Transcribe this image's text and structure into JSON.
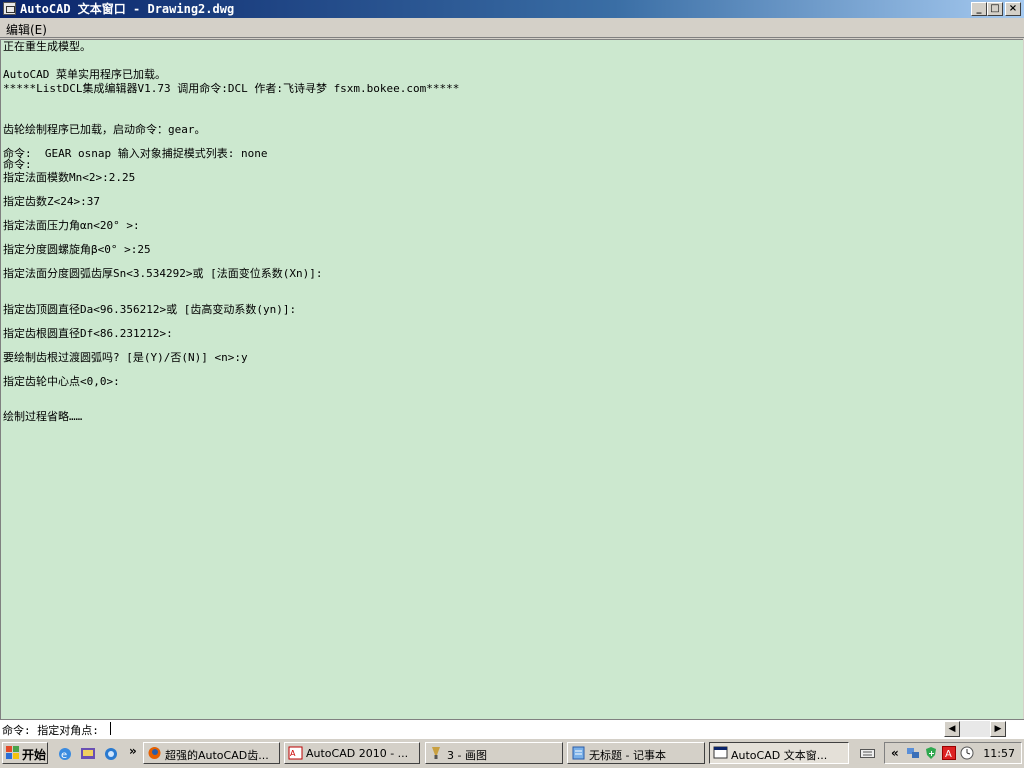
{
  "window": {
    "title": "AutoCAD 文本窗口 - Drawing2.dwg",
    "minimize_glyph": "_",
    "maximize_glyph": "□",
    "close_glyph": "×"
  },
  "menu": {
    "edit_label": "编辑(E)"
  },
  "log": [
    "正在重生成模型。",
    "AutoCAD 菜单实用程序已加载。",
    "*****ListDCL集成编辑器V1.73 调用命令:DCL 作者:飞诗寻梦 fsxm.bokee.com*****",
    "齿轮绘制程序已加载，启动命令：gear。",
    "命令:  GEAR osnap 输入对象捕捉模式列表: none",
    "命令:",
    "指定法面模数Mn<2>:2.25",
    "指定齿数Z<24>:37",
    "指定法面压力角αn<20° >:",
    "指定分度圆螺旋角β<0° >:25",
    "指定法面分度圆弧齿厚Sn<3.534292>或 [法面变位系数(Xn)]:",
    "指定齿顶圆直径Da<96.356212>或 [齿高变动系数(yn)]:",
    "指定齿根圆直径Df<86.231212>:",
    "要绘制齿根过渡圆弧吗? [是(Y)/否(N)] <n>:y",
    "指定齿轮中心点<0,0>:",
    "绘制过程省略……"
  ],
  "command_line": {
    "text": "命令: 指定对角点:"
  },
  "scrollbar": {
    "left_glyph": "◀",
    "right_glyph": "▶"
  },
  "taskbar": {
    "start_label": "开始",
    "overflow_glyph": "»",
    "tray_overflow_glyph": "«",
    "clock": "11:57",
    "tasks": [
      {
        "label": "超强的AutoCAD齿...",
        "icon": "firefox-icon"
      },
      {
        "label": "AutoCAD 2010 - ...",
        "icon": "autocad-icon"
      },
      {
        "label": "3 - 画图",
        "icon": "paint-icon"
      },
      {
        "label": "无标题 - 记事本",
        "icon": "notepad-icon"
      },
      {
        "label": "AutoCAD 文本窗...",
        "icon": "text-window-icon",
        "active": true
      }
    ]
  },
  "colors": {
    "text_window_bg": "#cce8cf",
    "titlebar_start": "#0a246a",
    "taskbar_bg": "#d4d0c8"
  }
}
